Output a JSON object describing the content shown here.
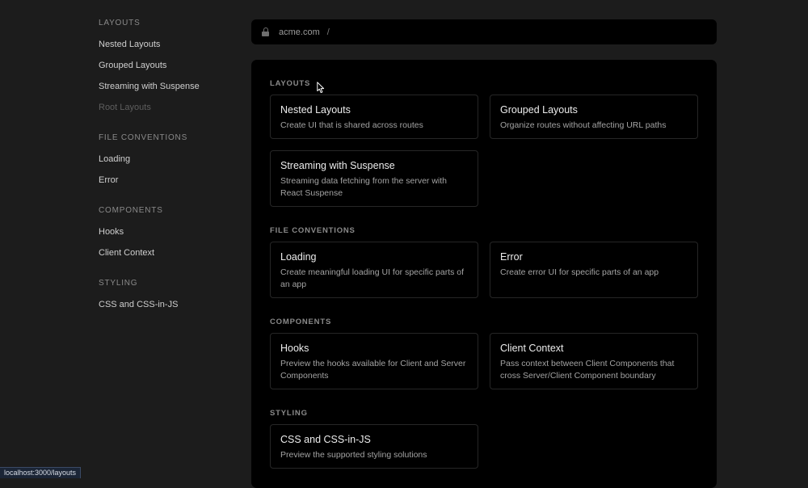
{
  "sidebar": {
    "sections": [
      {
        "heading": "LAYOUTS",
        "items": [
          "Nested Layouts",
          "Grouped Layouts",
          "Streaming with Suspense",
          "Root Layouts"
        ]
      },
      {
        "heading": "FILE CONVENTIONS",
        "items": [
          "Loading",
          "Error"
        ]
      },
      {
        "heading": "COMPONENTS",
        "items": [
          "Hooks",
          "Client Context"
        ]
      },
      {
        "heading": "STYLING",
        "items": [
          "CSS and CSS-in-JS"
        ]
      }
    ]
  },
  "address": {
    "domain": "acme.com",
    "separator": "/"
  },
  "main": {
    "layouts": {
      "heading": "LAYOUTS",
      "cards": [
        {
          "title": "Nested Layouts",
          "desc": "Create UI that is shared across routes"
        },
        {
          "title": "Grouped Layouts",
          "desc": "Organize routes without affecting URL paths"
        },
        {
          "title": "Streaming with Suspense",
          "desc": "Streaming data fetching from the server with React Suspense"
        }
      ]
    },
    "file_conventions": {
      "heading": "FILE CONVENTIONS",
      "cards": [
        {
          "title": "Loading",
          "desc": "Create meaningful loading UI for specific parts of an app"
        },
        {
          "title": "Error",
          "desc": "Create error UI for specific parts of an app"
        }
      ]
    },
    "components": {
      "heading": "COMPONENTS",
      "cards": [
        {
          "title": "Hooks",
          "desc": "Preview the hooks available for Client and Server Components"
        },
        {
          "title": "Client Context",
          "desc": "Pass context between Client Components that cross Server/Client Component boundary"
        }
      ]
    },
    "styling": {
      "heading": "STYLING",
      "cards": [
        {
          "title": "CSS and CSS-in-JS",
          "desc": "Preview the supported styling solutions"
        }
      ]
    }
  },
  "status": {
    "url": "localhost:3000/layouts"
  }
}
